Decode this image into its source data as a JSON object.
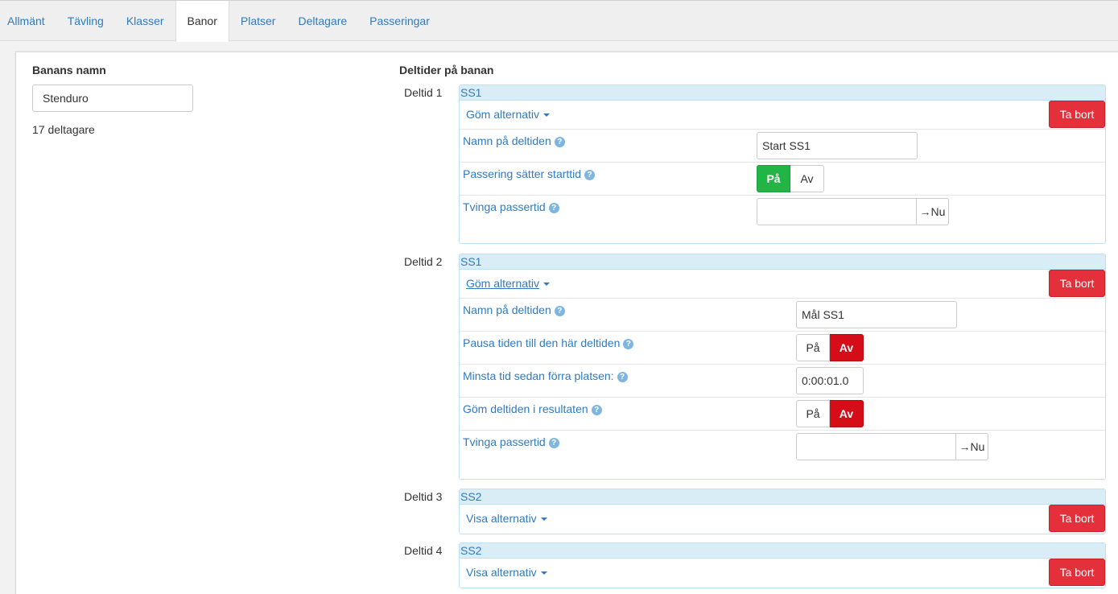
{
  "tabs": [
    {
      "label": "Allmänt"
    },
    {
      "label": "Tävling"
    },
    {
      "label": "Klasser"
    },
    {
      "label": "Banor"
    },
    {
      "label": "Platser"
    },
    {
      "label": "Deltagare"
    },
    {
      "label": "Passeringar"
    }
  ],
  "active_tab": "Banor",
  "course": {
    "name_label": "Banans namn",
    "name_value": "Stenduro",
    "participants": "17 deltagare"
  },
  "splits_heading": "Deltider på banan",
  "remove_label": "Ta bort",
  "now_label": "→Nu",
  "on_label": "På",
  "off_label": "Av",
  "help_glyph": "?",
  "deltids": [
    {
      "label": "Deltid 1",
      "header": "SS1",
      "options_toggle": "Göm alternativ",
      "name_label": "Namn på deltiden",
      "name_value": "Start SS1",
      "start_label": "Passering sätter starttid",
      "start_value": "På",
      "force_label": "Tvinga passertid",
      "force_value": ""
    },
    {
      "label": "Deltid 2",
      "header": "SS1",
      "options_toggle": "Göm alternativ",
      "name_label": "Namn på deltiden",
      "name_value": "Mål SS1",
      "pause_label": "Pausa tiden till den här deltiden",
      "pause_value": "Av",
      "min_label": "Minsta tid sedan förra platsen:",
      "min_value": "0:00:01.0",
      "hide_label": "Göm deltiden i resultaten",
      "hide_value": "Av",
      "force_label": "Tvinga passertid",
      "force_value": ""
    },
    {
      "label": "Deltid 3",
      "header": "SS2",
      "options_toggle": "Visa alternativ"
    },
    {
      "label": "Deltid 4",
      "header": "SS2",
      "options_toggle": "Visa alternativ"
    }
  ],
  "colors": {
    "link": "#2f7ac0",
    "danger": "#e3303a",
    "toggle_on_green": "#22b545",
    "toggle_on_red": "#d40d19",
    "deltid_header_bg": "#d9edf7"
  }
}
